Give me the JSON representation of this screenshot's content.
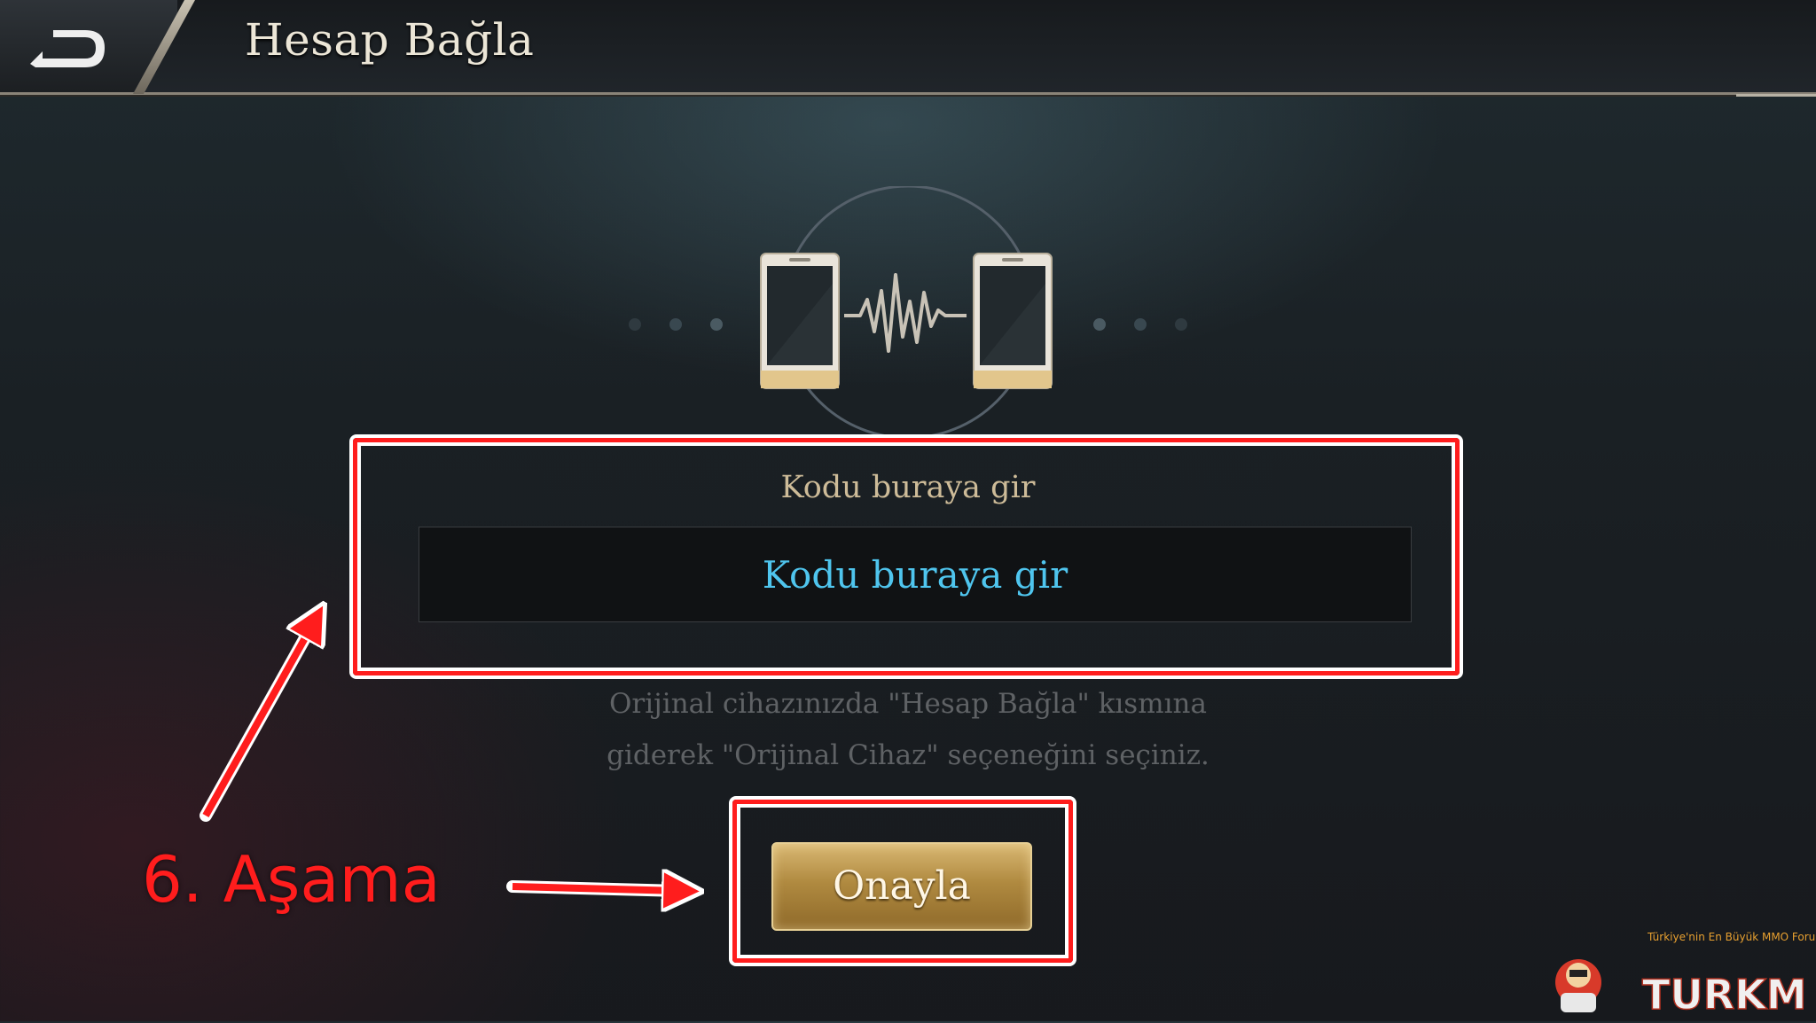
{
  "header": {
    "title": "Hesap Bağla",
    "back_icon": "back-arrow-icon"
  },
  "illustration": {
    "description_icons": [
      "phone-icon",
      "signal-wave-icon",
      "phone-icon"
    ]
  },
  "code_section": {
    "label": "Kodu buraya gir",
    "input_placeholder": "Kodu buraya gir",
    "input_value": ""
  },
  "info_text": {
    "line1": "Orijinal cihazınızda \"Hesap Bağla\" kısmına",
    "line2": "giderek \"Orijinal Cihaz\" seçeneğini seçiniz."
  },
  "confirm_button": {
    "label": "Onayla"
  },
  "annotation": {
    "step_label": "6. Aşama",
    "highlight_color": "#ff1d1d"
  },
  "watermark": {
    "brand": "TURKMMO",
    "tagline": "Türkiye'nin En Büyük MMO Forumu"
  },
  "colors": {
    "input_text": "#4fc5ee",
    "label_text": "#cdbb98",
    "button_gold": "#b08a40"
  }
}
